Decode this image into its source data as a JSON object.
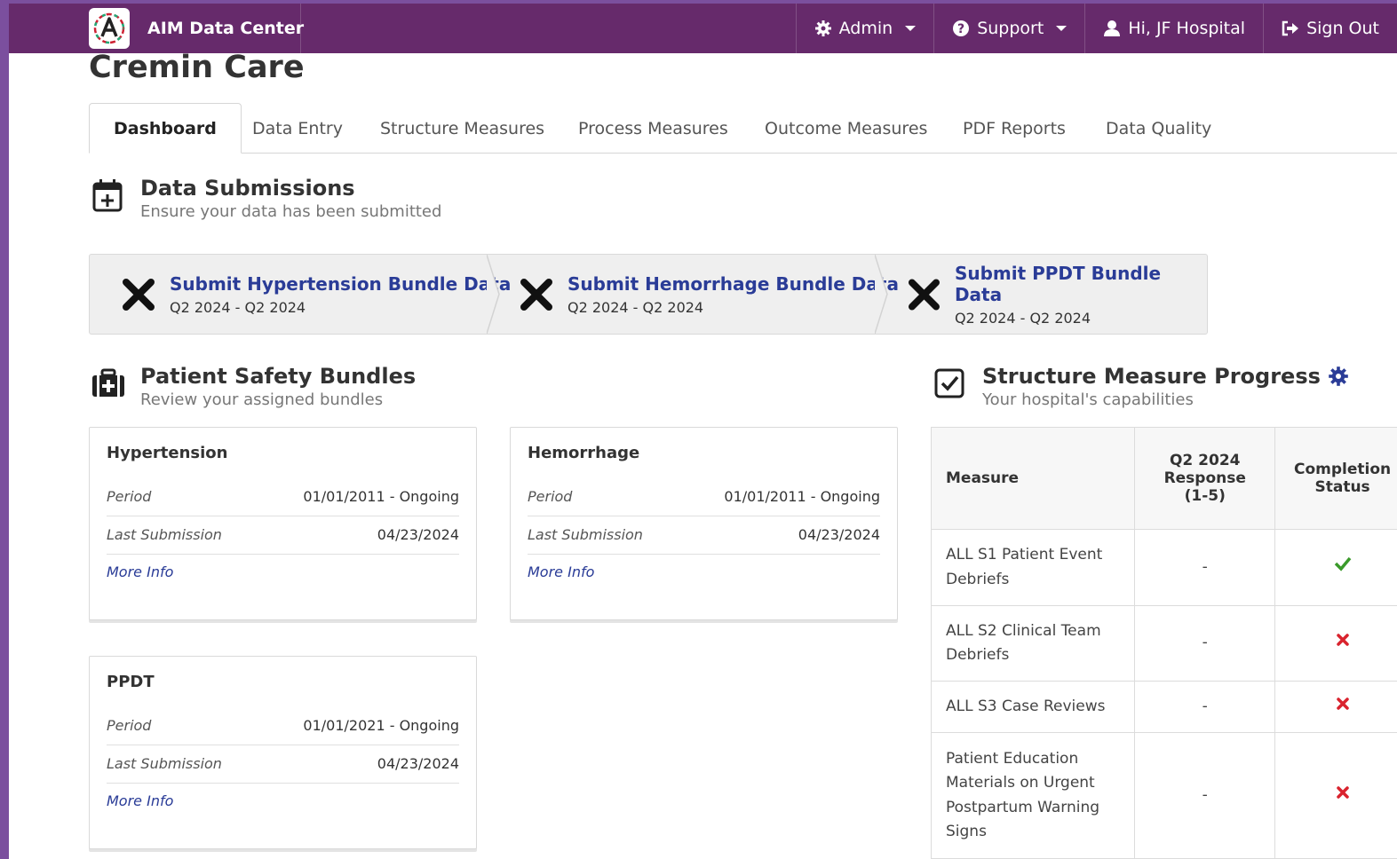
{
  "navbar": {
    "brand": "AIM Data Center",
    "items": [
      {
        "label": "Admin",
        "icon": "gear-icon",
        "dropdown": true
      },
      {
        "label": "Support",
        "icon": "question-circle-icon",
        "dropdown": true
      },
      {
        "label": "Hi, JF Hospital",
        "icon": "user-icon",
        "dropdown": false
      },
      {
        "label": "Sign Out",
        "icon": "sign-out-icon",
        "dropdown": false
      }
    ]
  },
  "page": {
    "title": "Cremin Care"
  },
  "tabs": [
    {
      "label": "Dashboard",
      "active": true
    },
    {
      "label": "Data Entry",
      "active": false
    },
    {
      "label": "Structure Measures",
      "active": false
    },
    {
      "label": "Process Measures",
      "active": false
    },
    {
      "label": "Outcome Measures",
      "active": false
    },
    {
      "label": "PDF Reports",
      "active": false
    },
    {
      "label": "Data Quality",
      "active": false
    }
  ],
  "submissions": {
    "title": "Data Submissions",
    "subtitle": "Ensure your data has been submitted",
    "steps": [
      {
        "label": "Submit Hypertension Bundle Data",
        "period": "Q2 2024 - Q2 2024",
        "status": "incomplete"
      },
      {
        "label": "Submit Hemorrhage Bundle Data",
        "period": "Q2 2024 - Q2 2024",
        "status": "incomplete"
      },
      {
        "label": "Submit PPDT Bundle Data",
        "period": "Q2 2024 - Q2 2024",
        "status": "incomplete"
      }
    ]
  },
  "bundles": {
    "title": "Patient Safety Bundles",
    "subtitle": "Review your assigned bundles",
    "period_label": "Period",
    "last_label": "Last Submission",
    "more_label": "More Info",
    "cards": [
      {
        "name": "Hypertension",
        "period": "01/01/2011 - Ongoing",
        "last_submission": "04/23/2024"
      },
      {
        "name": "Hemorrhage",
        "period": "01/01/2011 - Ongoing",
        "last_submission": "04/23/2024"
      },
      {
        "name": "PPDT",
        "period": "01/01/2021 - Ongoing",
        "last_submission": "04/23/2024"
      }
    ]
  },
  "structure": {
    "title": "Structure Measure Progress",
    "subtitle": "Your hospital's capabilities",
    "headers": {
      "measure": "Measure",
      "response": "Q2 2024 Response (1-5)",
      "status": "Completion Status"
    },
    "rows": [
      {
        "measure": "ALL S1 Patient Event Debriefs",
        "response": "-",
        "status": "complete"
      },
      {
        "measure": "ALL S2 Clinical Team Debriefs",
        "response": "-",
        "status": "incomplete"
      },
      {
        "measure": "ALL S3 Case Reviews",
        "response": "-",
        "status": "incomplete"
      },
      {
        "measure": "Patient Education Materials on Urgent Postpartum Warning Signs",
        "response": "-",
        "status": "incomplete"
      }
    ]
  },
  "colors": {
    "navbar": "#662a6b",
    "link": "#2a3c97",
    "check": "#3a9a2a",
    "cross": "#d9232e",
    "gear_accent": "#2a3c97"
  }
}
